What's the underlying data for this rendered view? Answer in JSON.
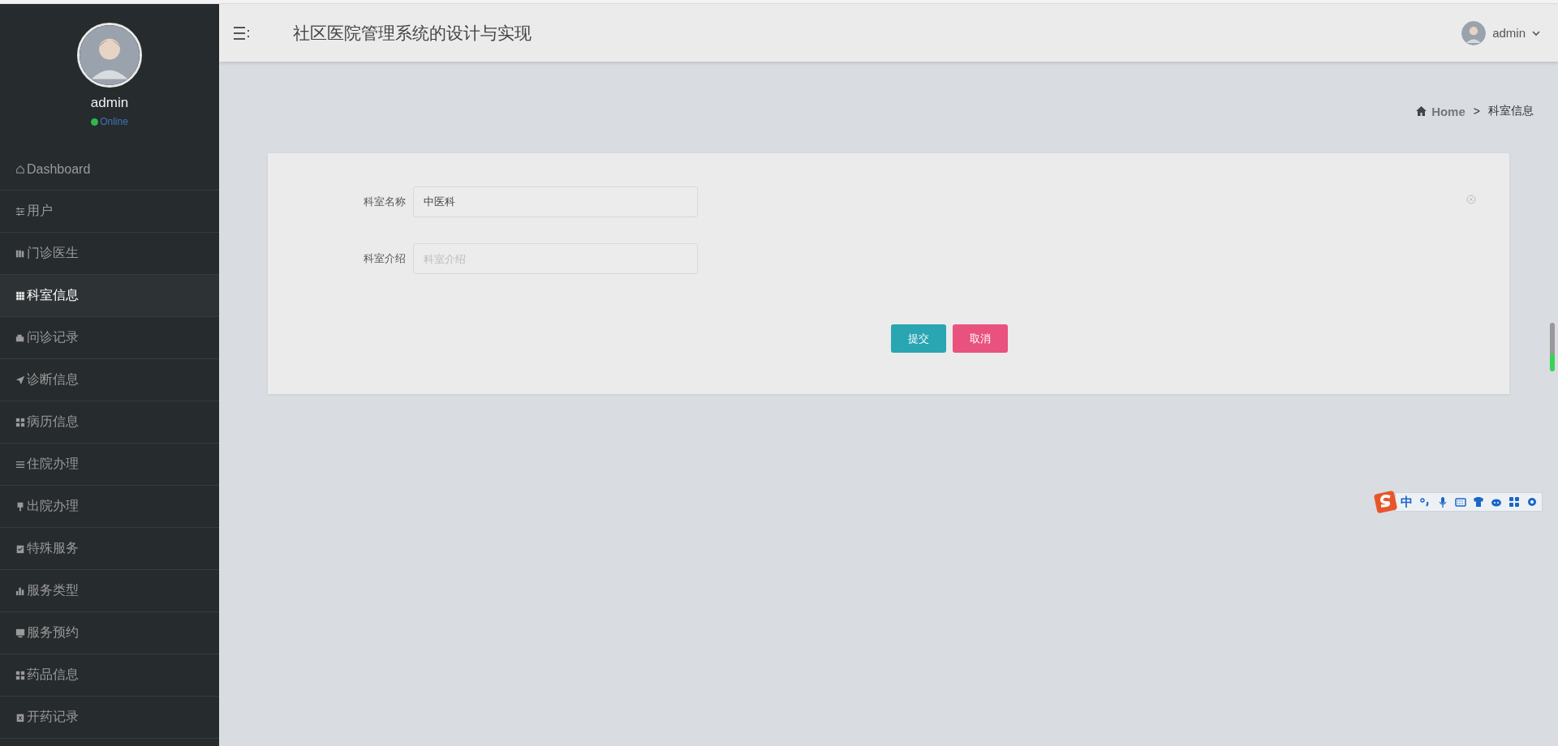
{
  "sidebar": {
    "user": {
      "name": "admin",
      "status": "Online"
    },
    "items": [
      {
        "label": "Dashboard",
        "selected": false
      },
      {
        "label": "用户",
        "selected": false
      },
      {
        "label": "门诊医生",
        "selected": false
      },
      {
        "label": "科室信息",
        "selected": true
      },
      {
        "label": "问诊记录",
        "selected": false
      },
      {
        "label": "诊断信息",
        "selected": false
      },
      {
        "label": "病历信息",
        "selected": false
      },
      {
        "label": "住院办理",
        "selected": false
      },
      {
        "label": "出院办理",
        "selected": false
      },
      {
        "label": "特殊服务",
        "selected": false
      },
      {
        "label": "服务类型",
        "selected": false
      },
      {
        "label": "服务预约",
        "selected": false
      },
      {
        "label": "药品信息",
        "selected": false
      },
      {
        "label": "开药记录",
        "selected": false
      }
    ]
  },
  "header": {
    "title": "社区医院管理系统的设计与实现",
    "user": "admin"
  },
  "breadcrumb": {
    "home": "Home",
    "separator": ">",
    "current": "科室信息"
  },
  "form": {
    "fields": [
      {
        "label": "科室名称",
        "value": "中医科"
      },
      {
        "label": "科室介绍",
        "placeholder": "科室介绍"
      }
    ],
    "buttons": [
      {
        "label": "提交",
        "kind": "submit"
      },
      {
        "label": "取消",
        "kind": "cancel"
      }
    ]
  },
  "ime_toolbar": {
    "mode": "中"
  }
}
